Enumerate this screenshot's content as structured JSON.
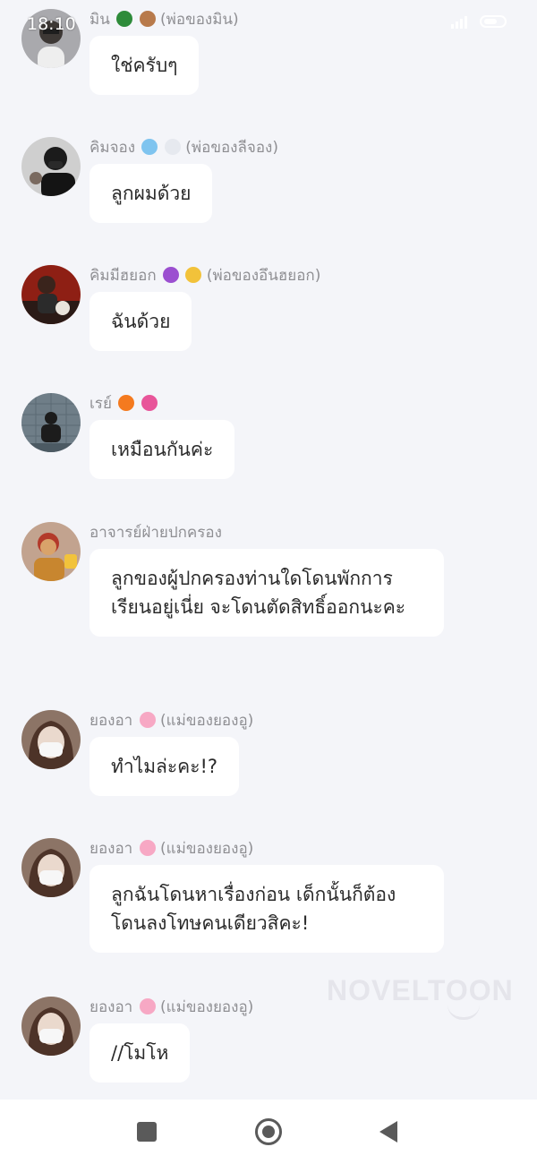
{
  "status_bar": {
    "time": "18:10"
  },
  "messages": [
    {
      "sender": "มิน",
      "emojis": [
        "tree-emoji",
        "wood-emoji"
      ],
      "sender_suffix": "(พ่อของมิน)",
      "text": "ใช่ครับๆ"
    },
    {
      "sender": "คิมจอง",
      "emojis": [
        "snowflake-emoji",
        "snowman-emoji"
      ],
      "sender_suffix": "(พ่อของลีจอง)",
      "text": "ลูกผมด้วย"
    },
    {
      "sender": "คิมมีฮยอก",
      "emojis": [
        "devil-emoji",
        "sunglasses-emoji"
      ],
      "sender_suffix": "(พ่อของอึนฮยอก)",
      "text": "ฉันด้วย"
    },
    {
      "sender": "เรย์",
      "emojis": [
        "fire-emoji",
        "nail-polish-emoji"
      ],
      "sender_suffix": "",
      "text": "เหมือนกันค่ะ"
    },
    {
      "sender": "อาจารย์ฝ่ายปกครอง",
      "emojis": [],
      "sender_suffix": "",
      "text": "ลูกของผู้ปกครองท่านใดโดนพักการเรียนอยู่เนี่ย จะโดนตัดสิทธิ์ออกนะคะ"
    },
    {
      "sender": "ยองอา",
      "emojis": [
        "cherry-blossom-emoji"
      ],
      "sender_suffix": "(แม่ของยองอู)",
      "text": "ทำไมล่ะคะ!?"
    },
    {
      "sender": "ยองอา",
      "emojis": [
        "cherry-blossom-emoji"
      ],
      "sender_suffix": "(แม่ของยองอู)",
      "text": "ลูกฉันโดนหาเรื่องก่อน เด็กนั้นก็ต้องโดนลงโทษคนเดียวสิคะ!"
    },
    {
      "sender": "ยองอา",
      "emojis": [
        "cherry-blossom-emoji"
      ],
      "sender_suffix": "(แม่ของยองอู)",
      "text": "//โมโห"
    }
  ],
  "watermark": "NOVELTOON",
  "colors": {
    "background": "#f4f5f9",
    "bubble": "#ffffff",
    "sender_text": "#8f8f93",
    "message_text": "#2a2a2a",
    "nav_icons": "#5a5a5a"
  }
}
